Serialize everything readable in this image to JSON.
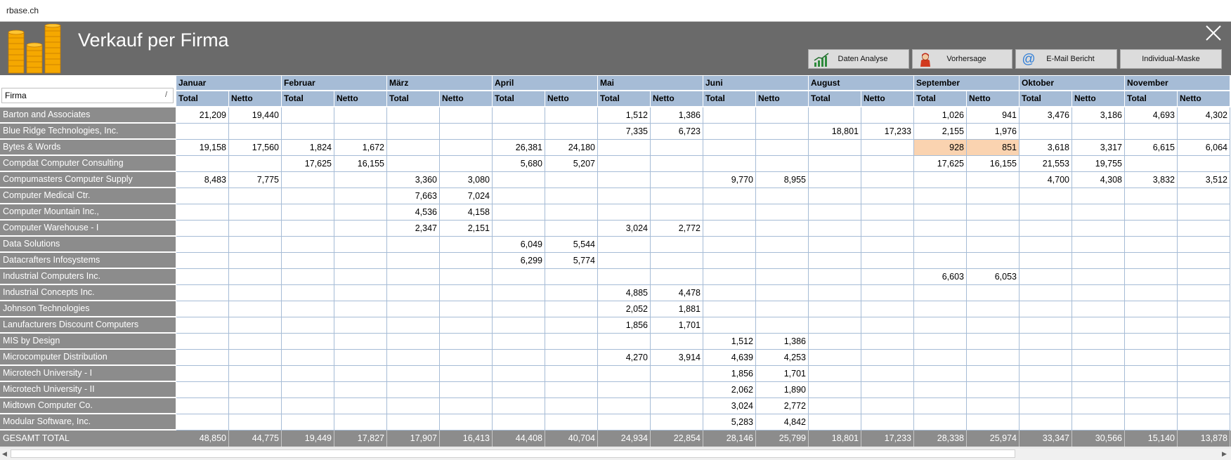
{
  "window": {
    "title": "rbase.ch"
  },
  "header": {
    "title": "Verkauf per Firma"
  },
  "toolbar": {
    "data_analysis": "Daten Analyse",
    "forecast": "Vorhersage",
    "email_report": "E-Mail Bericht",
    "custom_mask": "Individual-Maske"
  },
  "filter": {
    "label": "Firma",
    "icon": "/"
  },
  "months": [
    "Januar",
    "Februar",
    "März",
    "April",
    "Mai",
    "Juni",
    "August",
    "September",
    "Oktober",
    "November"
  ],
  "subheaders": {
    "total": "Total",
    "netto": "Netto"
  },
  "rows": [
    {
      "firma": "Barton and Associates",
      "values": [
        "21,209",
        "19,440",
        "",
        "",
        "",
        "",
        "",
        "",
        "1,512",
        "1,386",
        "",
        "",
        "",
        "",
        "1,026",
        "941",
        "3,476",
        "3,186",
        "4,693",
        "4,302"
      ]
    },
    {
      "firma": "Blue Ridge Technologies, Inc.",
      "values": [
        "",
        "",
        "",
        "",
        "",
        "",
        "",
        "",
        "7,335",
        "6,723",
        "",
        "",
        "18,801",
        "17,233",
        "2,155",
        "1,976",
        "",
        "",
        "",
        ""
      ]
    },
    {
      "firma": "Bytes & Words",
      "values": [
        "19,158",
        "17,560",
        "1,824",
        "1,672",
        "",
        "",
        "26,381",
        "24,180",
        "",
        "",
        "",
        "",
        "",
        "",
        "928",
        "851",
        "3,618",
        "3,317",
        "6,615",
        "6,064"
      ]
    },
    {
      "firma": "Compdat Computer Consulting",
      "values": [
        "",
        "",
        "17,625",
        "16,155",
        "",
        "",
        "5,680",
        "5,207",
        "",
        "",
        "",
        "",
        "",
        "",
        "17,625",
        "16,155",
        "21,553",
        "19,755",
        "",
        ""
      ]
    },
    {
      "firma": "Compumasters Computer Supply",
      "values": [
        "8,483",
        "7,775",
        "",
        "",
        "3,360",
        "3,080",
        "",
        "",
        "",
        "",
        "9,770",
        "8,955",
        "",
        "",
        "",
        "",
        "4,700",
        "4,308",
        "3,832",
        "3,512"
      ]
    },
    {
      "firma": "Computer Medical Ctr.",
      "values": [
        "",
        "",
        "",
        "",
        "7,663",
        "7,024",
        "",
        "",
        "",
        "",
        "",
        "",
        "",
        "",
        "",
        "",
        "",
        "",
        "",
        ""
      ]
    },
    {
      "firma": "Computer Mountain Inc.,",
      "values": [
        "",
        "",
        "",
        "",
        "4,536",
        "4,158",
        "",
        "",
        "",
        "",
        "",
        "",
        "",
        "",
        "",
        "",
        "",
        "",
        "",
        ""
      ]
    },
    {
      "firma": "Computer Warehouse - I",
      "values": [
        "",
        "",
        "",
        "",
        "2,347",
        "2,151",
        "",
        "",
        "3,024",
        "2,772",
        "",
        "",
        "",
        "",
        "",
        "",
        "",
        "",
        "",
        ""
      ]
    },
    {
      "firma": "Data Solutions",
      "values": [
        "",
        "",
        "",
        "",
        "",
        "",
        "6,049",
        "5,544",
        "",
        "",
        "",
        "",
        "",
        "",
        "",
        "",
        "",
        "",
        "",
        ""
      ]
    },
    {
      "firma": "Datacrafters Infosystems",
      "values": [
        "",
        "",
        "",
        "",
        "",
        "",
        "6,299",
        "5,774",
        "",
        "",
        "",
        "",
        "",
        "",
        "",
        "",
        "",
        "",
        "",
        ""
      ]
    },
    {
      "firma": "Industrial Computers Inc.",
      "values": [
        "",
        "",
        "",
        "",
        "",
        "",
        "",
        "",
        "",
        "",
        "",
        "",
        "",
        "",
        "6,603",
        "6,053",
        "",
        "",
        "",
        ""
      ]
    },
    {
      "firma": "Industrial Concepts Inc.",
      "values": [
        "",
        "",
        "",
        "",
        "",
        "",
        "",
        "",
        "4,885",
        "4,478",
        "",
        "",
        "",
        "",
        "",
        "",
        "",
        "",
        "",
        ""
      ]
    },
    {
      "firma": "Johnson Technologies",
      "values": [
        "",
        "",
        "",
        "",
        "",
        "",
        "",
        "",
        "2,052",
        "1,881",
        "",
        "",
        "",
        "",
        "",
        "",
        "",
        "",
        "",
        ""
      ]
    },
    {
      "firma": "Lanufacturers Discount Computers",
      "values": [
        "",
        "",
        "",
        "",
        "",
        "",
        "",
        "",
        "1,856",
        "1,701",
        "",
        "",
        "",
        "",
        "",
        "",
        "",
        "",
        "",
        ""
      ]
    },
    {
      "firma": "MIS by Design",
      "values": [
        "",
        "",
        "",
        "",
        "",
        "",
        "",
        "",
        "",
        "",
        "1,512",
        "1,386",
        "",
        "",
        "",
        "",
        "",
        "",
        "",
        ""
      ]
    },
    {
      "firma": "Microcomputer Distribution",
      "values": [
        "",
        "",
        "",
        "",
        "",
        "",
        "",
        "",
        "4,270",
        "3,914",
        "4,639",
        "4,253",
        "",
        "",
        "",
        "",
        "",
        "",
        "",
        ""
      ]
    },
    {
      "firma": "Microtech University - I",
      "values": [
        "",
        "",
        "",
        "",
        "",
        "",
        "",
        "",
        "",
        "",
        "1,856",
        "1,701",
        "",
        "",
        "",
        "",
        "",
        "",
        "",
        ""
      ]
    },
    {
      "firma": "Microtech University - II",
      "values": [
        "",
        "",
        "",
        "",
        "",
        "",
        "",
        "",
        "",
        "",
        "2,062",
        "1,890",
        "",
        "",
        "",
        "",
        "",
        "",
        "",
        ""
      ]
    },
    {
      "firma": "Midtown Computer Co.",
      "values": [
        "",
        "",
        "",
        "",
        "",
        "",
        "",
        "",
        "",
        "",
        "3,024",
        "2,772",
        "",
        "",
        "",
        "",
        "",
        "",
        "",
        ""
      ]
    },
    {
      "firma": "Modular Software, Inc.",
      "values": [
        "",
        "",
        "",
        "",
        "",
        "",
        "",
        "",
        "",
        "",
        "5,283",
        "4,842",
        "",
        "",
        "",
        "",
        "",
        "",
        "",
        ""
      ]
    }
  ],
  "highlight": {
    "row": 2,
    "cols": [
      14,
      15
    ],
    "color": "#fad3b0"
  },
  "total": {
    "label": "GESAMT TOTAL",
    "values": [
      "48,850",
      "44,775",
      "19,449",
      "17,827",
      "17,907",
      "16,413",
      "44,408",
      "40,704",
      "24,934",
      "22,854",
      "28,146",
      "25,799",
      "18,801",
      "17,233",
      "28,338",
      "25,974",
      "33,347",
      "30,566",
      "15,140",
      "13,878"
    ]
  },
  "icons": [
    "coins-logo-icon",
    "close-icon",
    "chart-icon",
    "person-icon",
    "at-icon"
  ],
  "colors": {
    "header_bg": "#6a6a6a",
    "column_header_bg": "#a6bcd6",
    "row_label_bg": "#8c8c8c",
    "grid_line": "#a6bcd6"
  }
}
